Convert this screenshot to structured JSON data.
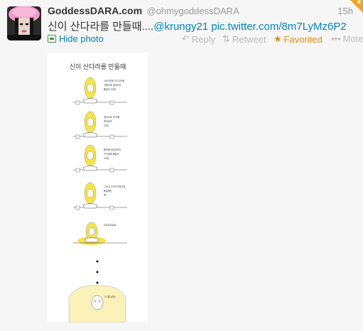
{
  "tweet": {
    "full_name": "GoddessDARA.com",
    "username": "@ohmygoddessDARA",
    "time": "15h",
    "text_main": "신이 산다라를 만들때....",
    "text_mention": "@krungy21",
    "text_link": "pic.twitter.com/8m7LyMz6P2"
  },
  "actions": {
    "hide_photo": "Hide photo",
    "reply": "Reply",
    "retweet": "Retweet",
    "favorited": "Favorited",
    "more": "More"
  },
  "photo": {
    "title": "신이 산다라를 만들때",
    "panels": [
      {
        "lines": [
          "2003년에 2013년에",
          "귀엽도록 열세히고",
          "빵걸어 50접"
        ]
      },
      {
        "lines": [
          "생것으로 써 보람",
          "휴어로만",
          "50접"
        ]
      },
      {
        "lines": [
          "빠져에 비겁인하는",
          "굿기일에 빵걸어",
          "50접"
        ]
      },
      {
        "lines": [
          "그리고 인가이구하인걸",
          "빠걸에는",
          "쪽..."
        ]
      },
      {
        "lines": [
          "주르르르르르"
        ]
      }
    ],
    "final_caption": "이 멀 남아..."
  },
  "colors": {
    "link": "#0084b4",
    "favorited": "#e08a10",
    "hair_yellow": "#f7e34a",
    "corner_badge": "#f4a020"
  }
}
